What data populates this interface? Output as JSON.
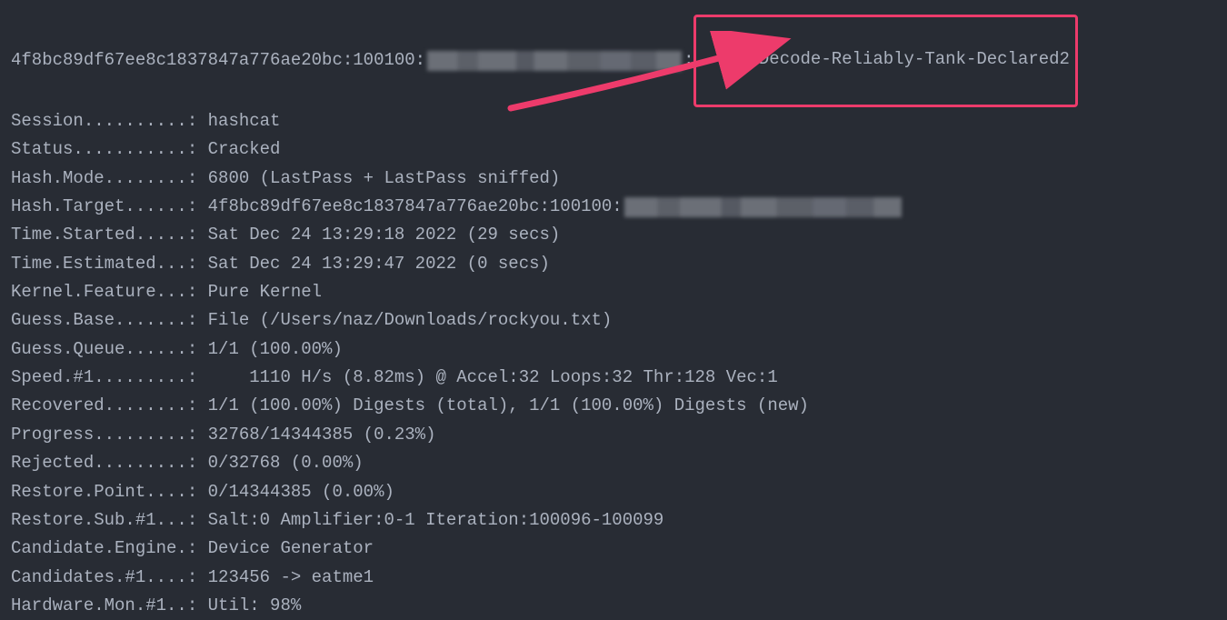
{
  "crackedLine": {
    "hash": "4f8bc89df67ee8c1837847a776ae20bc:100100:",
    "password": "Decode-Reliably-Tank-Declared2"
  },
  "lines": {
    "session": "Session..........: hashcat",
    "status": "Status...........: Cracked",
    "hashMode": "Hash.Mode........: 6800 (LastPass + LastPass sniffed)",
    "hashTargetPre": "Hash.Target......: 4f8bc89df67ee8c1837847a776ae20bc:100100:",
    "timeStarted": "Time.Started.....: Sat Dec 24 13:29:18 2022 (29 secs)",
    "timeEstimated": "Time.Estimated...: Sat Dec 24 13:29:47 2022 (0 secs)",
    "kernelFeature": "Kernel.Feature...: Pure Kernel",
    "guessBase": "Guess.Base.......: File (/Users/naz/Downloads/rockyou.txt)",
    "guessQueue": "Guess.Queue......: 1/1 (100.00%)",
    "speed": "Speed.#1.........:     1110 H/s (8.82ms) @ Accel:32 Loops:32 Thr:128 Vec:1",
    "recovered": "Recovered........: 1/1 (100.00%) Digests (total), 1/1 (100.00%) Digests (new)",
    "progress": "Progress.........: 32768/14344385 (0.23%)",
    "rejected": "Rejected.........: 0/32768 (0.00%)",
    "restorePoint": "Restore.Point....: 0/14344385 (0.00%)",
    "restoreSub": "Restore.Sub.#1...: Salt:0 Amplifier:0-1 Iteration:100096-100099",
    "candidateEngine": "Candidate.Engine.: Device Generator",
    "candidates": "Candidates.#1....: 123456 -> eatme1",
    "hardwareMon": "Hardware.Mon.#1..: Util: 98%"
  },
  "annotation": {
    "arrowColor": "#ed3b6b"
  }
}
